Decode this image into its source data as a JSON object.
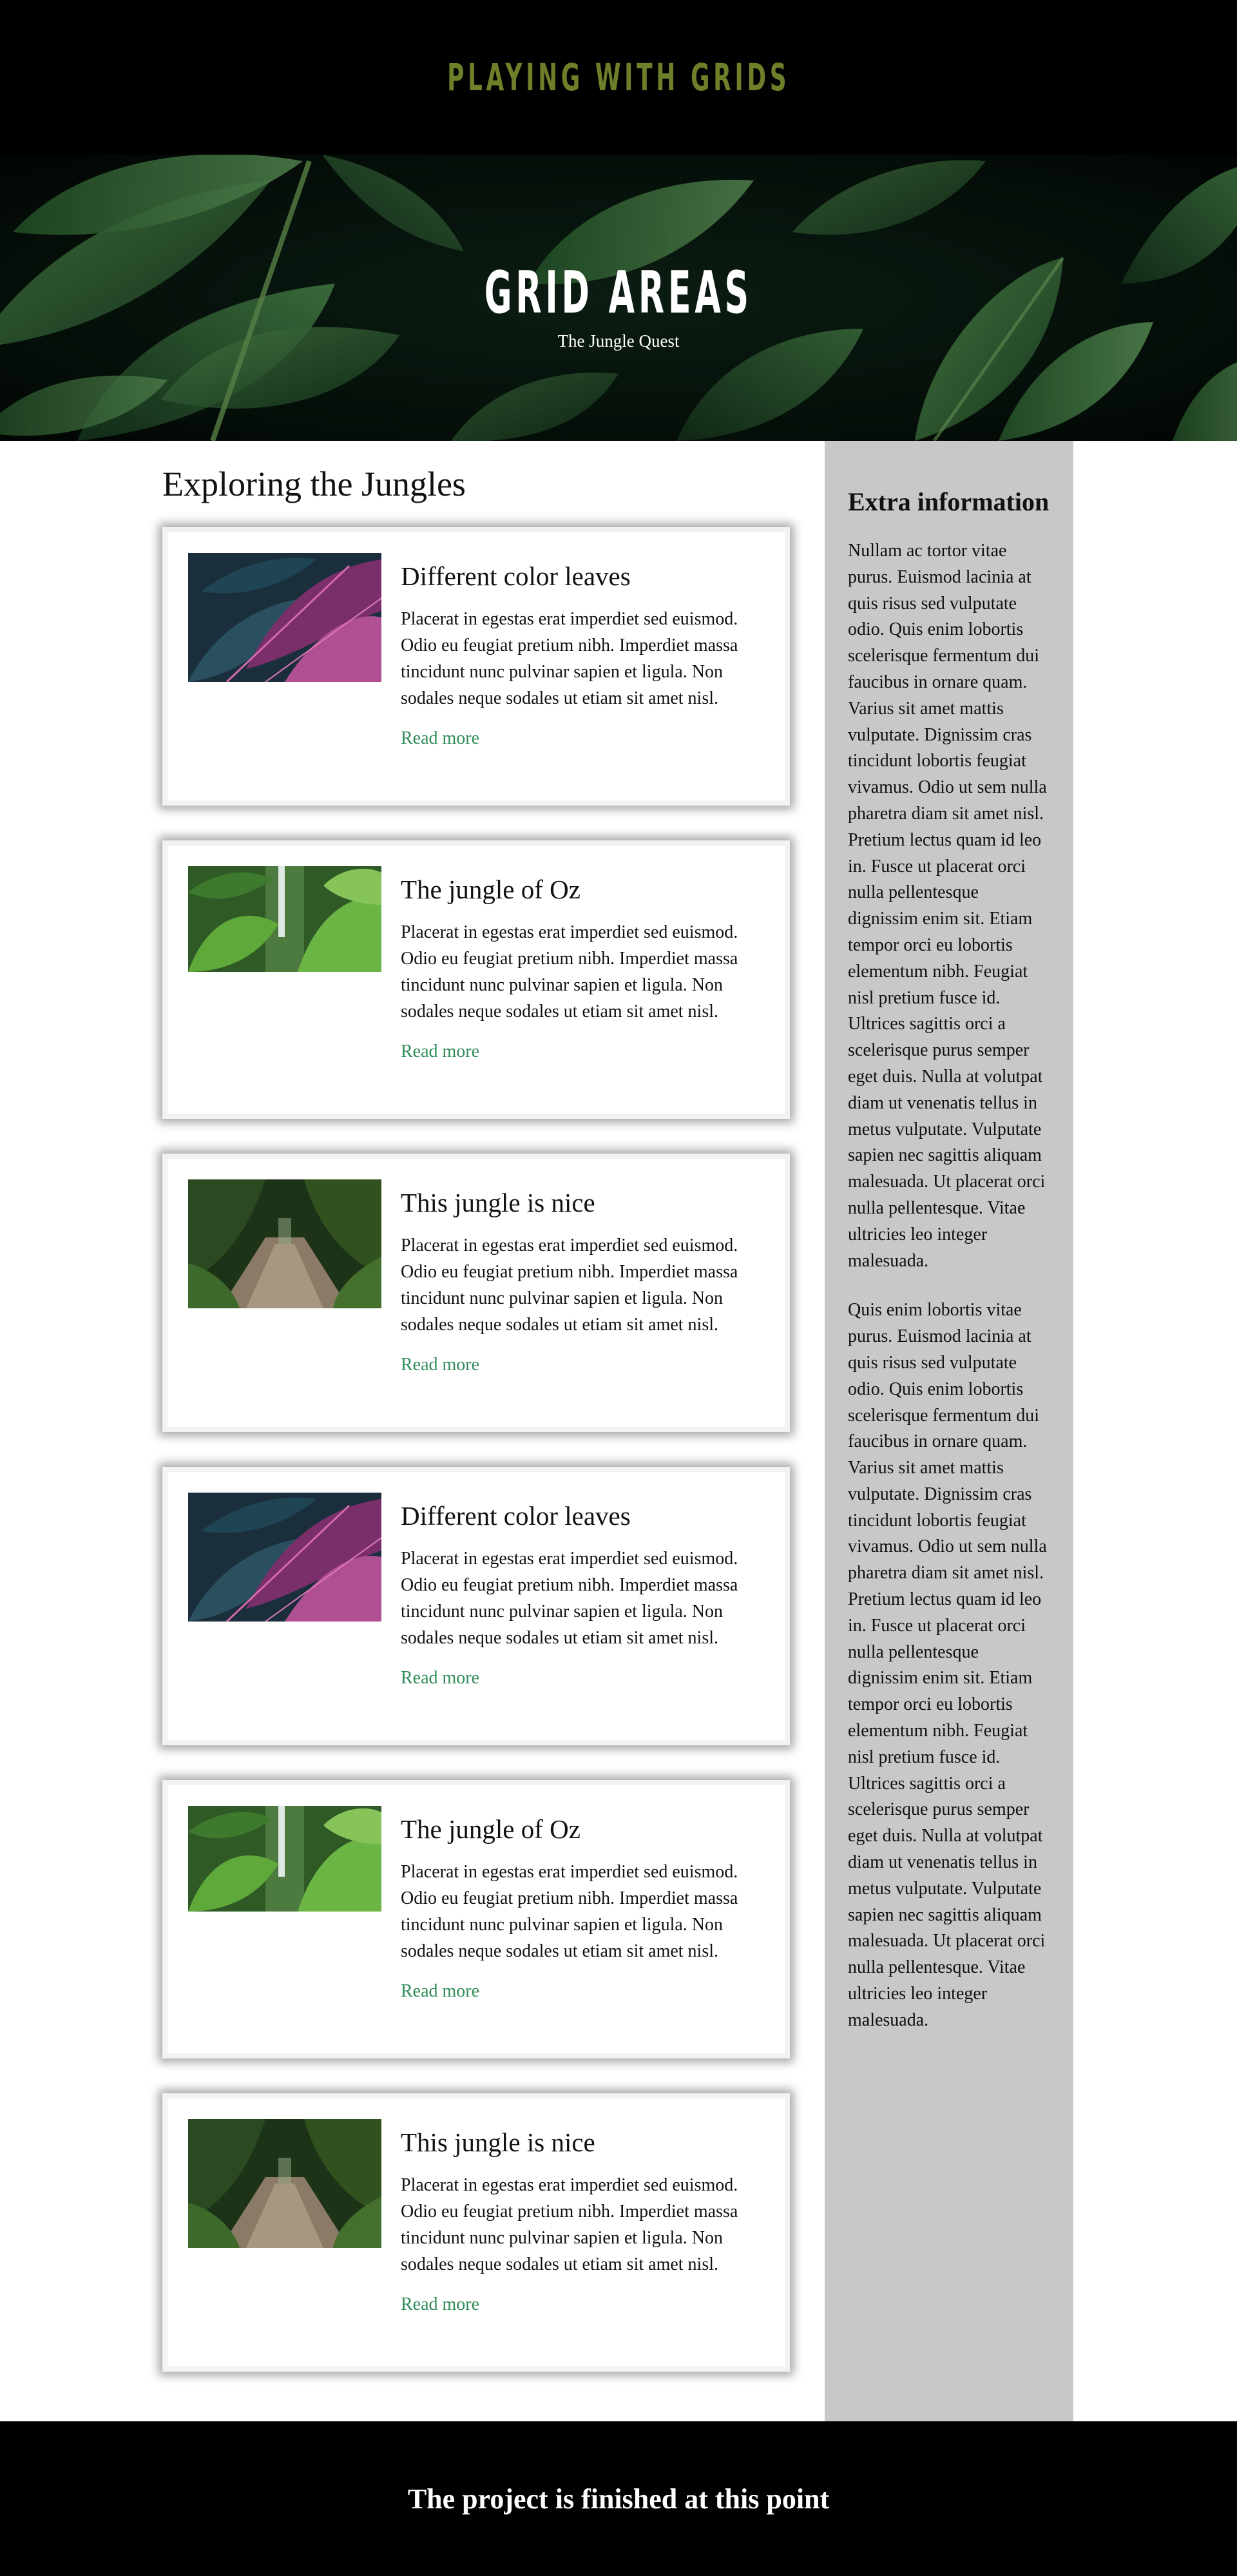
{
  "header": {
    "site_title": "PLAYING WITH GRIDS"
  },
  "hero": {
    "title": "GRID AREAS",
    "subtitle": "The Jungle Quest"
  },
  "main": {
    "section_title": "Exploring the Jungles",
    "cards": [
      {
        "image": "purple-leaves-image",
        "title": "Different color leaves",
        "text": "Placerat in egestas erat imperdiet sed euismod. Odio eu feugiat pretium nibh. Imperdiet massa tincidunt nunc pulvinar sapien et ligula. Non sodales neque sodales ut etiam sit amet nisl.",
        "link": "Read more"
      },
      {
        "image": "waterfall-jungle-image",
        "title": "The jungle of Oz",
        "text": "Placerat in egestas erat imperdiet sed euismod. Odio eu feugiat pretium nibh. Imperdiet massa tincidunt nunc pulvinar sapien et ligula. Non sodales neque sodales ut etiam sit amet nisl.",
        "link": "Read more"
      },
      {
        "image": "jungle-path-image",
        "title": "This jungle is nice",
        "text": "Placerat in egestas erat imperdiet sed euismod. Odio eu feugiat pretium nibh. Imperdiet massa tincidunt nunc pulvinar sapien et ligula. Non sodales neque sodales ut etiam sit amet nisl.",
        "link": "Read more"
      },
      {
        "image": "purple-leaves-image",
        "title": "Different color leaves",
        "text": "Placerat in egestas erat imperdiet sed euismod. Odio eu feugiat pretium nibh. Imperdiet massa tincidunt nunc pulvinar sapien et ligula. Non sodales neque sodales ut etiam sit amet nisl.",
        "link": "Read more"
      },
      {
        "image": "waterfall-jungle-image",
        "title": "The jungle of Oz",
        "text": "Placerat in egestas erat imperdiet sed euismod. Odio eu feugiat pretium nibh. Imperdiet massa tincidunt nunc pulvinar sapien et ligula. Non sodales neque sodales ut etiam sit amet nisl.",
        "link": "Read more"
      },
      {
        "image": "jungle-path-image",
        "title": "This jungle is nice",
        "text": "Placerat in egestas erat imperdiet sed euismod. Odio eu feugiat pretium nibh. Imperdiet massa tincidunt nunc pulvinar sapien et ligula. Non sodales neque sodales ut etiam sit amet nisl.",
        "link": "Read more"
      }
    ]
  },
  "sidebar": {
    "title": "Extra information",
    "paragraphs": [
      "Nullam ac tortor vitae purus. Euismod lacinia at quis risus sed vulputate odio. Quis enim lobortis scelerisque fermentum dui faucibus in ornare quam. Varius sit amet mattis vulputate. Dignissim cras tincidunt lobortis feugiat vivamus. Odio ut sem nulla pharetra diam sit amet nisl. Pretium lectus quam id leo in. Fusce ut placerat orci nulla pellentesque dignissim enim sit. Etiam tempor orci eu lobortis elementum nibh. Feugiat nisl pretium fusce id. Ultrices sagittis orci a scelerisque purus semper eget duis. Nulla at volutpat diam ut venenatis tellus in metus vulputate. Vulputate sapien nec sagittis aliquam malesuada. Ut placerat orci nulla pellentesque. Vitae ultricies leo integer malesuada.",
      "Quis enim lobortis vitae purus. Euismod lacinia at quis risus sed vulputate odio. Quis enim lobortis scelerisque fermentum dui faucibus in ornare quam. Varius sit amet mattis vulputate. Dignissim cras tincidunt lobortis feugiat vivamus. Odio ut sem nulla pharetra diam sit amet nisl. Pretium lectus quam id leo in. Fusce ut placerat orci nulla pellentesque dignissim enim sit. Etiam tempor orci eu lobortis elementum nibh. Feugiat nisl pretium fusce id. Ultrices sagittis orci a scelerisque purus semper eget duis. Nulla at volutpat diam ut venenatis tellus in metus vulputate. Vulputate sapien nec sagittis aliquam malesuada. Ut placerat orci nulla pellentesque. Vitae ultricies leo integer malesuada."
    ]
  },
  "footer": {
    "text": "The project is finished at this point"
  },
  "colors": {
    "title_olive": "#6e7f2a",
    "link_green": "#2e8b57",
    "sidebar_gray": "#c8c8c8",
    "bar_black": "#000000"
  }
}
